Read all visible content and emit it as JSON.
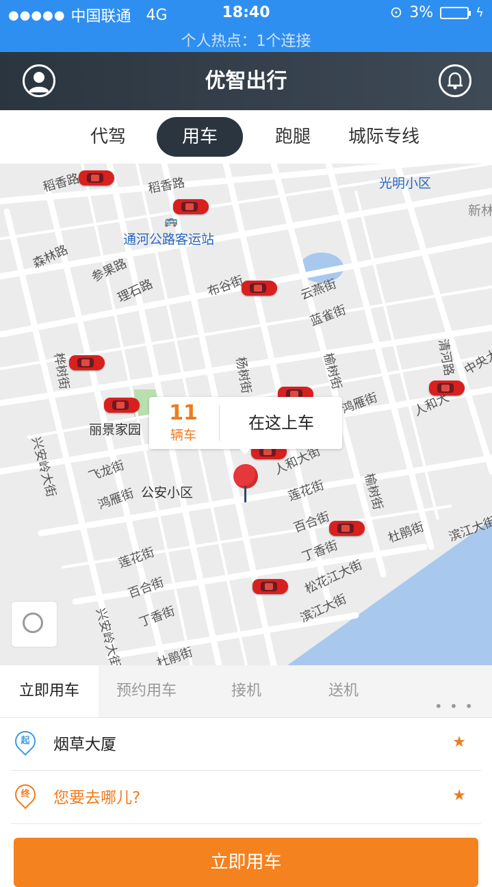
{
  "status_bar": {
    "carrier": "中国联通",
    "network": "4G",
    "time": "18:40",
    "battery": "3%",
    "hotspot": "个人热点：1个连接"
  },
  "app_bar": {
    "title": "优智出行"
  },
  "service_tabs": [
    {
      "label": "代驾",
      "active": false
    },
    {
      "label": "用车",
      "active": true
    },
    {
      "label": "跑腿",
      "active": false
    },
    {
      "label": "城际专线",
      "active": false
    }
  ],
  "map": {
    "streets": [
      "稻香路",
      "稻香路",
      "森林路",
      "参果路",
      "理石路",
      "布谷街",
      "云燕街",
      "蓝雀街",
      "杨树街",
      "榆树街",
      "鸿雁街",
      "清河路",
      "中央大",
      "人和大",
      "桦树街",
      "兴安岭大街",
      "飞龙街",
      "鸿雁街",
      "人和大街",
      "莲花街",
      "榆树街",
      "百合街",
      "杜鹃街",
      "滨江大街",
      "丁香街",
      "松花江大街",
      "滨江大街",
      "莲花街",
      "百合街",
      "丁香街",
      "兴安岭大街",
      "杜鹃街"
    ],
    "pois": {
      "bus_station": "通河公路客运站",
      "community_guangming": "光明小区",
      "community_xin": "新林",
      "garden": "丽景家园",
      "community_gongan": "公安小区"
    },
    "nearby_count": "11",
    "nearby_unit": "辆车",
    "pickup_label": "在这上车"
  },
  "booking_tabs": [
    {
      "label": "立即用车",
      "active": true
    },
    {
      "label": "预约用车",
      "active": false
    },
    {
      "label": "接机",
      "active": false
    },
    {
      "label": "送机",
      "active": false
    }
  ],
  "more_label": "• • •",
  "origin": {
    "badge": "起",
    "value": "烟草大厦"
  },
  "destination": {
    "badge": "终",
    "placeholder": "您要去哪儿?"
  },
  "cta_label": "立即用车",
  "colors": {
    "status_blue": "#2f8ff0",
    "accent_orange": "#f07b1c",
    "dark": "#2b3540",
    "water": "#a9c8ee"
  }
}
